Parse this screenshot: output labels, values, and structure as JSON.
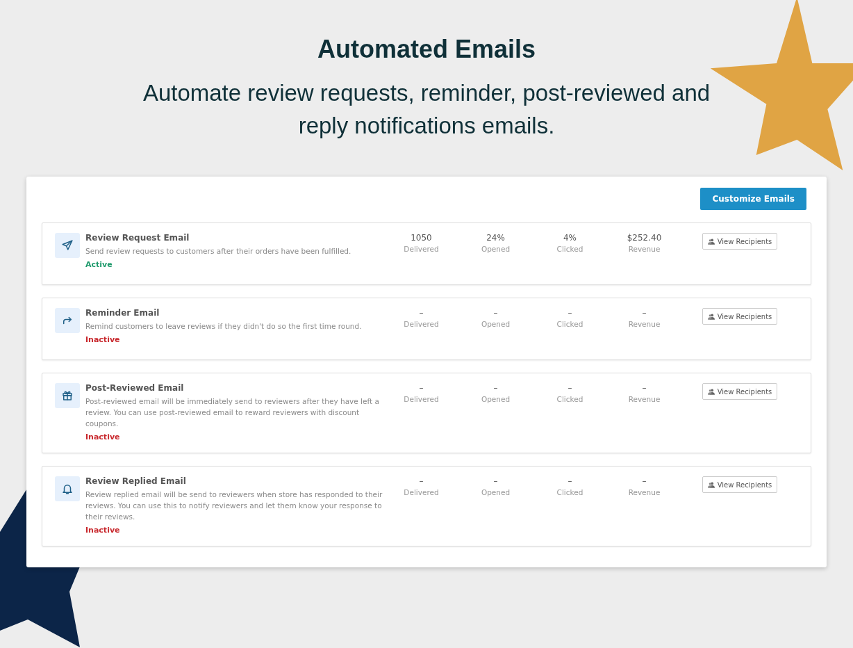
{
  "header": {
    "title": "Automated Emails",
    "subtitle": "Automate review requests, reminder, post-reviewed and reply notifications emails."
  },
  "customize_button": "Customize Emails",
  "emails": [
    {
      "kind": "send",
      "title": "Review Request Email",
      "description": "Send review requests to customers after their orders have been fulfilled.",
      "status": "Active",
      "active": true,
      "stats": [
        {
          "value": "1050",
          "label": "Delivered"
        },
        {
          "value": "24%",
          "label": "Opened"
        },
        {
          "value": "4%",
          "label": "Clicked"
        },
        {
          "value": "$252.40",
          "label": "Revenue"
        }
      ],
      "button": "View Recipients"
    },
    {
      "kind": "reminder",
      "title": "Reminder Email",
      "description": "Remind customers to leave reviews if they didn't do so the first time round.",
      "status": "Inactive",
      "active": false,
      "stats": [
        {
          "value": "–",
          "label": "Delivered"
        },
        {
          "value": "–",
          "label": "Opened"
        },
        {
          "value": "–",
          "label": "Clicked"
        },
        {
          "value": "–",
          "label": "Revenue"
        }
      ],
      "button": "View Recipients"
    },
    {
      "kind": "gift",
      "title": "Post-Reviewed Email",
      "description": "Post-reviewed email will be immediately send to reviewers after they have left a review. You can use post-reviewed email to reward reviewers with discount coupons.",
      "status": "Inactive",
      "active": false,
      "stats": [
        {
          "value": "–",
          "label": "Delivered"
        },
        {
          "value": "–",
          "label": "Opened"
        },
        {
          "value": "–",
          "label": "Clicked"
        },
        {
          "value": "–",
          "label": "Revenue"
        }
      ],
      "button": "View Recipients"
    },
    {
      "kind": "bell",
      "title": "Review Replied Email",
      "description": "Review replied email will be send to reviewers when store has responded to their reviews. You can use this to notify reviewers and let them know your response to their reviews.",
      "status": "Inactive",
      "active": false,
      "stats": [
        {
          "value": "–",
          "label": "Delivered"
        },
        {
          "value": "–",
          "label": "Opened"
        },
        {
          "value": "–",
          "label": "Clicked"
        },
        {
          "value": "–",
          "label": "Revenue"
        }
      ],
      "button": "View Recipients"
    }
  ]
}
